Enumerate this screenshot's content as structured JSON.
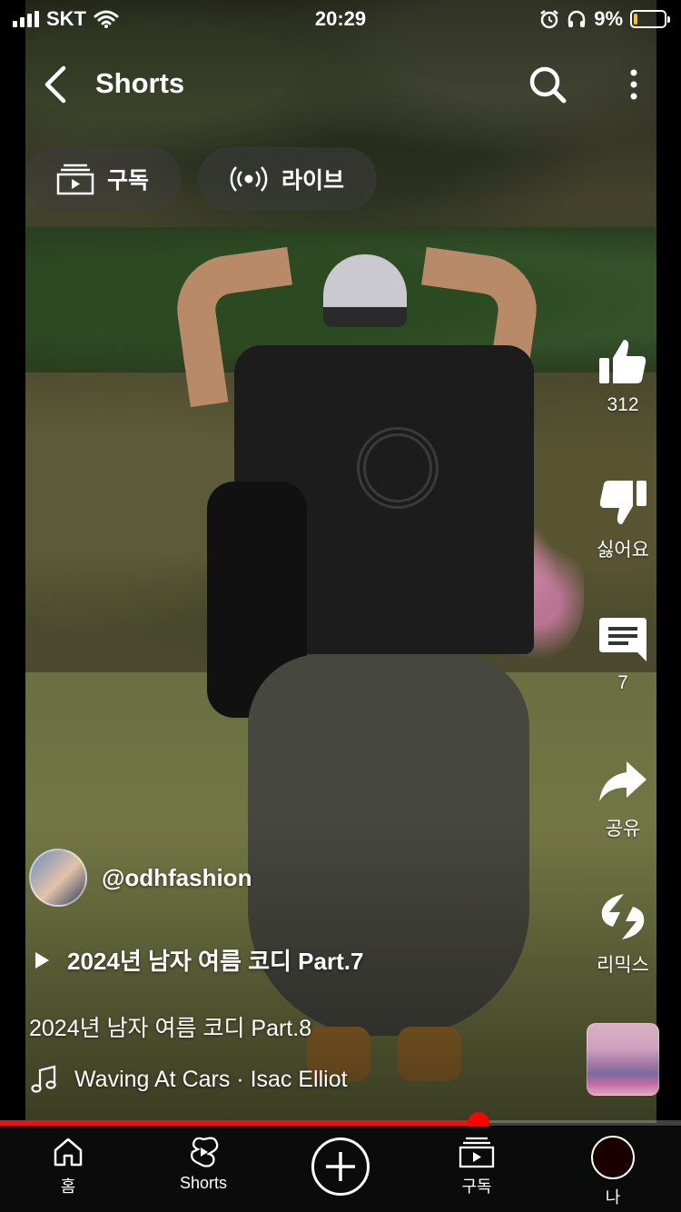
{
  "status_bar": {
    "carrier": "SKT",
    "time": "20:29",
    "battery": "9%",
    "battery_level": 0.09
  },
  "header": {
    "title": "Shorts",
    "chips": [
      {
        "label": "구독",
        "icon": "subscriptions-icon"
      },
      {
        "label": "라이브",
        "icon": "live-icon"
      }
    ]
  },
  "actions": {
    "like_count": "312",
    "dislike_label": "싫어요",
    "comment_count": "7",
    "share_label": "공유",
    "remix_label": "리믹스"
  },
  "video": {
    "channel": "@odhfashion",
    "playlist": "2024년 남자 여름 코디 Part.7",
    "title": "2024년 남자 여름 코디 Part.8",
    "music": "Waving At Cars · Isac Elliot",
    "progress": 0.703
  },
  "bottom_nav": {
    "home": "홈",
    "shorts": "Shorts",
    "subscriptions": "구독",
    "me": "나"
  },
  "colors": {
    "accent": "#ff0000",
    "battery": "#f4c430"
  }
}
